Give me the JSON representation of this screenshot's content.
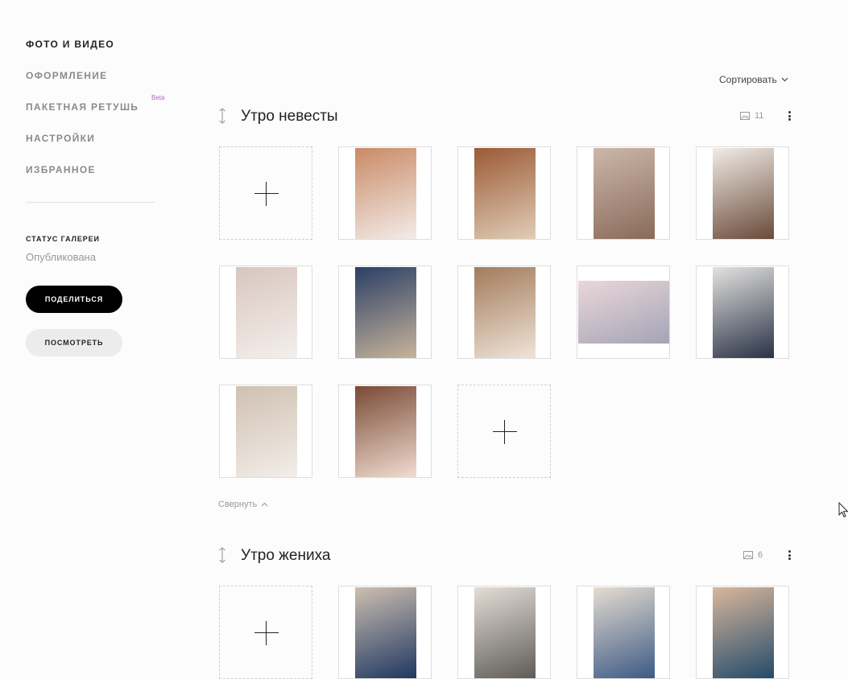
{
  "sidebar": {
    "nav": [
      {
        "label": "ФОТО И ВИДЕО"
      },
      {
        "label": "ОФОРМЛЕНИЕ"
      },
      {
        "label": "ПАКЕТНАЯ РЕТУШЬ"
      },
      {
        "label": "НАСТРОЙКИ"
      },
      {
        "label": "ИЗБРАННОЕ"
      }
    ],
    "beta": "Beta",
    "status_label": "СТАТУС ГАЛЕРЕИ",
    "status_value": "Опубликована",
    "share_label": "ПОДЕЛИТЬСЯ",
    "view_label": "ПОСМОТРЕТЬ"
  },
  "toolbar": {
    "sort_label": "Сортировать"
  },
  "sections": [
    {
      "title": "Утро невесты",
      "count": "11",
      "collapse_label": "Свернуть",
      "photos": [
        {
          "name": "photo-dress-back-lace",
          "colors": [
            "#c98a66",
            "#f3ece8"
          ]
        },
        {
          "name": "photo-mirror-red-shoes",
          "colors": [
            "#9b5a35",
            "#e0cdb7"
          ]
        },
        {
          "name": "photo-bride-at-mirror",
          "colors": [
            "#cbb7aa",
            "#8a6a5a"
          ]
        },
        {
          "name": "photo-bride-portrait",
          "colors": [
            "#f1ece6",
            "#6a4a3a"
          ]
        },
        {
          "name": "photo-dress-buttons",
          "colors": [
            "#d8c6be",
            "#f4efec"
          ]
        },
        {
          "name": "photo-groom-suit-blue",
          "colors": [
            "#2b3f66",
            "#c7b49a"
          ]
        },
        {
          "name": "photo-table-decor",
          "colors": [
            "#a37b5b",
            "#efe4d9"
          ]
        },
        {
          "name": "photo-dress-on-floor",
          "colors": [
            "#ead7d9",
            "#a4a4b6"
          ]
        },
        {
          "name": "photo-groom-mirror",
          "colors": [
            "#e3e2df",
            "#2a3246"
          ]
        },
        {
          "name": "photo-bride-window",
          "colors": [
            "#cfc0b1",
            "#f2eee9"
          ]
        },
        {
          "name": "photo-red-shoes-close",
          "colors": [
            "#7a4a36",
            "#f0dcd0"
          ]
        }
      ]
    },
    {
      "title": "Утро жениха",
      "count": "6",
      "photos": [
        {
          "name": "photo-groom-boutonniere",
          "colors": [
            "#cdbfb0",
            "#1f3760"
          ]
        },
        {
          "name": "photo-groom-vest",
          "colors": [
            "#e3ddd6",
            "#5f5c58"
          ]
        },
        {
          "name": "photo-hands-cufflinks",
          "colors": [
            "#e5dcd1",
            "#3d5a86"
          ]
        },
        {
          "name": "photo-groom-room",
          "colors": [
            "#d9b69b",
            "#234b6b"
          ]
        }
      ]
    }
  ]
}
